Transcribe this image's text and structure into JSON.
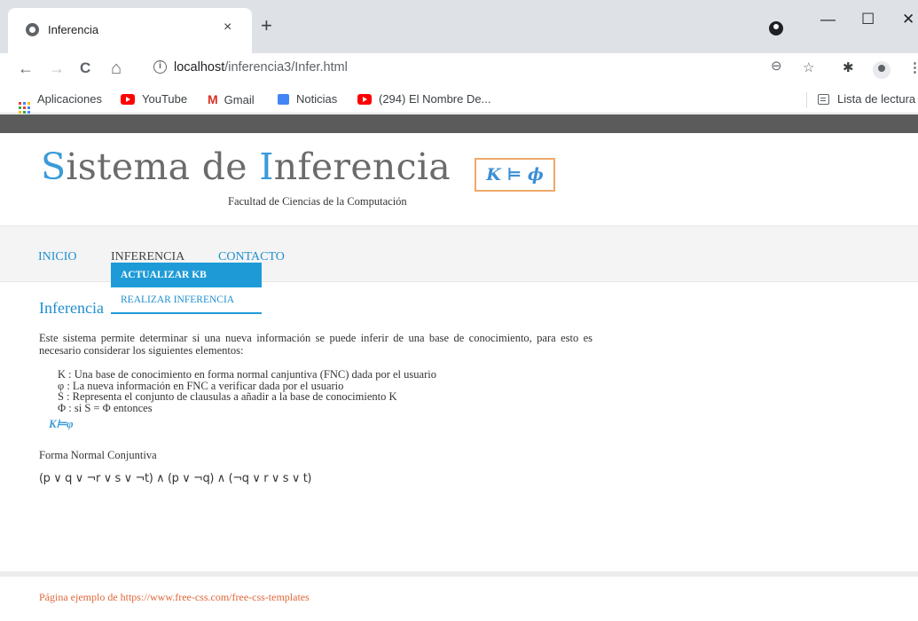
{
  "browser": {
    "tab_title": "Inferencia",
    "tab_close": "×",
    "new_tab": "+",
    "window_controls": {
      "minimize": "—",
      "maximize": "☐",
      "close": "✕"
    },
    "nav": {
      "back": "←",
      "forward": "→",
      "reload": "C",
      "home": "⌂"
    },
    "url_host": "localhost",
    "url_path": "/inferencia3/Infer.html",
    "info_icon": "i",
    "toolbar_icons": {
      "zoom": "⊖",
      "star": "☆",
      "extensions": "✱",
      "menu": "⋮"
    },
    "bookmarks": [
      {
        "label": "Aplicaciones",
        "icon": "apps-grid-icon"
      },
      {
        "label": "YouTube",
        "icon": "youtube-icon"
      },
      {
        "label": "Gmail",
        "icon": "gmail-icon",
        "glyph": "M"
      },
      {
        "label": "Noticias",
        "icon": "news-icon"
      },
      {
        "label": "(294) El Nombre De...",
        "icon": "youtube-icon"
      }
    ],
    "reading_list": "Lista de lectura"
  },
  "site": {
    "title_first_cap": "S",
    "title_part1": "istema de ",
    "title_second_cap": "I",
    "title_part2": "nferencia",
    "subtitle": "Facultad de Ciencias de la Computación",
    "logo_text": "K ⊨ ϕ",
    "colors": {
      "accent": "#1f8fcf",
      "topbar": "#5b5b5b",
      "logo_border": "#f0a86a",
      "footer_link": "#e0663a"
    }
  },
  "nav": {
    "items": [
      "INICIO",
      "INFERENCIA",
      "CONTACTO"
    ],
    "dropdown": [
      "ACTUALIZAR KB",
      "REALIZAR INFERENCIA"
    ]
  },
  "content": {
    "heading": "Inferencia",
    "intro": "Este sistema permite determinar si una nueva información se puede inferir de una base de conocimiento, para esto es necesario considerar los siguientes elementos:",
    "definitions": [
      "K : Una base de conocimiento en forma normal canjuntiva (FNC) dada por el usuario",
      "φ : La nueva información en FNC a verificar dada por el usuario",
      "S : Representa el conjunto de clausulas a añadir a la base de conocimiento K",
      "Φ : si S = Φ entonces"
    ],
    "formula": "K⊨φ",
    "fnc_label": "Forma Normal Conjuntiva",
    "fnc_formula": "(p ∨ q ∨ ¬r ∨ s ∨ ¬t) ∧ (p ∨ ¬q) ∧ (¬q ∨ r ∨ s ∨ t)"
  },
  "footer": {
    "text": "Página ejemplo de https://www.free-css.com/free-css-templates"
  }
}
